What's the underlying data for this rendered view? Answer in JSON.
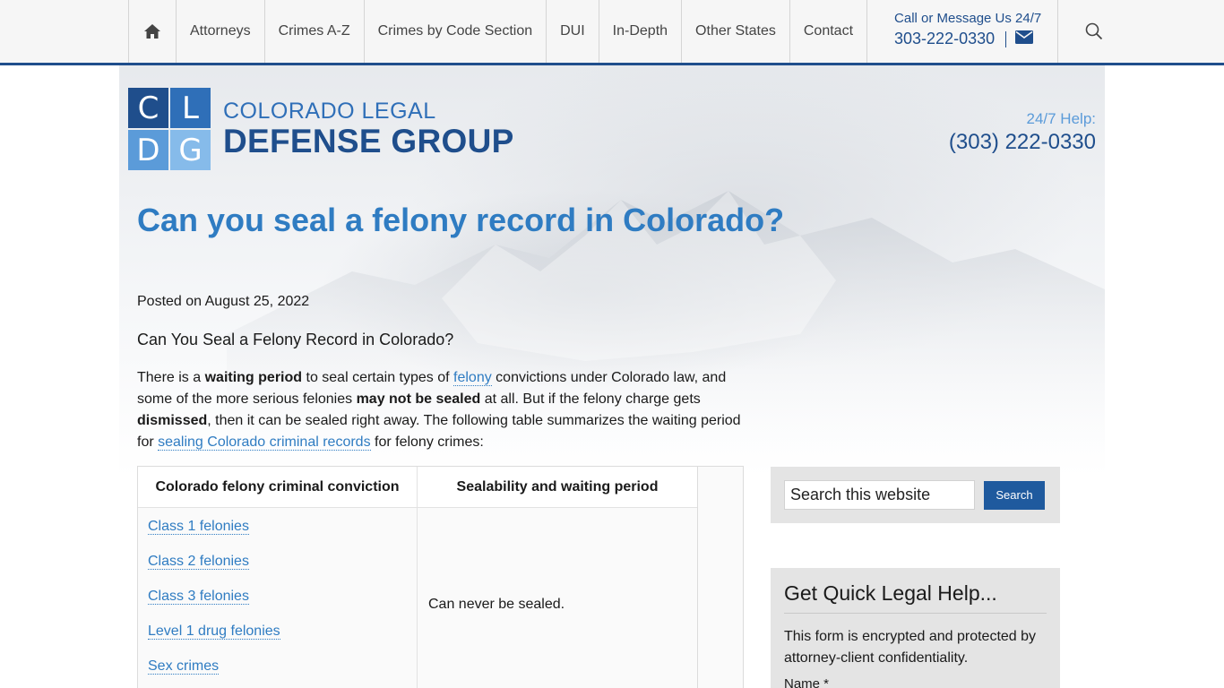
{
  "nav": {
    "home_icon": "home-icon",
    "items": [
      {
        "label": "Attorneys"
      },
      {
        "label": "Crimes A-Z"
      },
      {
        "label": "Crimes by Code Section"
      },
      {
        "label": "DUI"
      },
      {
        "label": "In-Depth"
      },
      {
        "label": "Other States"
      },
      {
        "label": "Contact"
      }
    ],
    "call_caption": "Call or Message Us 24/7",
    "call_number": "303-222-0330",
    "email_icon": "envelope-icon",
    "search_icon": "search-icon"
  },
  "logo": {
    "letters": [
      "C",
      "L",
      "D",
      "G"
    ],
    "line1": "COLORADO LEGAL",
    "line2": "DEFENSE GROUP"
  },
  "help": {
    "caption": "24/7 Help:",
    "number": "(303) 222-0330"
  },
  "article": {
    "title": "Can you seal a felony record in Colorado?",
    "posted": "Posted on August 25, 2022",
    "subhead": "Can You Seal a Felony Record in Colorado?",
    "para": {
      "t1": "There is a ",
      "b1": "waiting period",
      "t2": " to seal certain types of ",
      "link1": "felony",
      "t3": " convictions under Colorado law, and some of the more serious felonies ",
      "b2": "may not be sealed",
      "t4": " at all. But if the felony charge gets ",
      "b3": "dismissed",
      "t5": ", then it can be sealed right away. The following table summarizes the waiting period for ",
      "link2": "sealing Colorado criminal records",
      "t6": " for felony crimes:"
    },
    "table": {
      "headers": [
        "Colorado felony criminal conviction",
        "Sealability and waiting period"
      ],
      "links": [
        "Class 1 felonies",
        "Class 2 felonies",
        "Class 3 felonies",
        "Level 1 drug felonies",
        "Sex crimes"
      ],
      "value": "Can never be sealed."
    }
  },
  "sidebar": {
    "search_value": "Search this website",
    "search_button": "Search",
    "form_heading": "Get Quick Legal Help...",
    "form_text": "This form is encrypted and protected by attorney-client confidentiality.",
    "form_label": "Name *"
  },
  "colors": {
    "navy": "#1f4e8c",
    "title_blue": "#2f7cc2",
    "link_blue": "#2f7cc2"
  }
}
